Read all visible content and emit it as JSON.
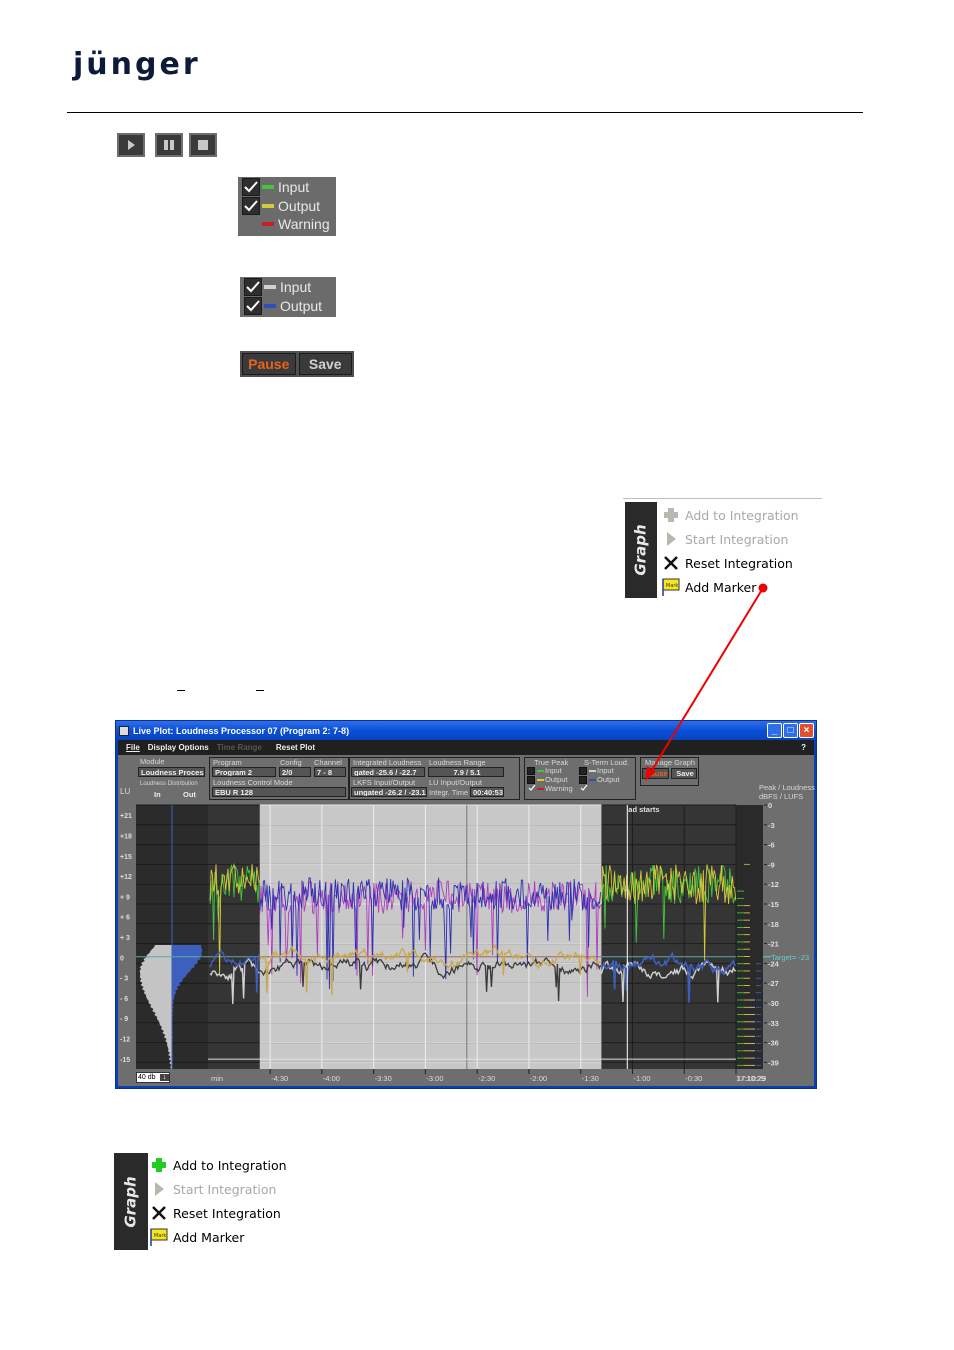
{
  "logo": {
    "text": "jünger"
  },
  "transport": {
    "buttons": [
      {
        "name": "play",
        "icon": "play-icon"
      },
      {
        "name": "pause",
        "icon": "pause-icon"
      },
      {
        "name": "stop",
        "icon": "stop-icon"
      }
    ]
  },
  "true_peak_legend": {
    "items": [
      {
        "label": "Input",
        "checked": true,
        "color": "#44c43c"
      },
      {
        "label": "Output",
        "checked": true,
        "color": "#d8c83c"
      },
      {
        "label": "Warning",
        "checked": false,
        "color": "#c81e28"
      }
    ]
  },
  "short_term_legend": {
    "items": [
      {
        "label": "Input",
        "checked": true,
        "color": "#d0d0d0"
      },
      {
        "label": "Output",
        "checked": true,
        "color": "#2f4fb8"
      }
    ]
  },
  "manage_buttons": {
    "pause": "Pause",
    "save": "Save",
    "pause_color": "#e8641e"
  },
  "graph_menu_top": {
    "tab": "Graph",
    "items": [
      {
        "label": "Add to Integration",
        "icon": "plus-icon",
        "enabled": false
      },
      {
        "label": "Start Integration",
        "icon": "play-icon",
        "enabled": false
      },
      {
        "label": "Reset Integration",
        "icon": "cross-icon",
        "enabled": true
      },
      {
        "label": "Add Marker",
        "icon": "marker-flag-icon",
        "enabled": true
      }
    ]
  },
  "graph_menu_bottom": {
    "tab": "Graph",
    "items": [
      {
        "label": "Add to Integration",
        "icon": "plus-icon",
        "enabled": true
      },
      {
        "label": "Start Integration",
        "icon": "play-icon",
        "enabled": false
      },
      {
        "label": "Reset Integration",
        "icon": "cross-icon",
        "enabled": true
      },
      {
        "label": "Add Marker",
        "icon": "marker-flag-icon",
        "enabled": true
      }
    ]
  },
  "window": {
    "title": "Live Plot:  Loudness Processor 07  (Program 2: 7-8)",
    "menu": {
      "file": "File",
      "display_options": "Display Options",
      "time_range": "Time Range",
      "reset_plot": "Reset Plot",
      "help": "?"
    },
    "module": {
      "label": "Module",
      "value": "Loudness Process"
    },
    "program": {
      "label": "Program",
      "value": "Program 2"
    },
    "config": {
      "label": "Config",
      "value": "2/0"
    },
    "channel": {
      "label": "Channel",
      "value": "7 - 8"
    },
    "control_mode": {
      "label": "Loudness Control Mode",
      "value": "EBU R 128"
    },
    "distribution": {
      "label": "Loudness Distribution",
      "in": "In",
      "out": "Out"
    },
    "lu_label": "LU",
    "integrated": {
      "label": "Integrated Loudness",
      "value": "gated    -25.6 / -22.7"
    },
    "lkfs": {
      "label": "LKFS Input/Output",
      "value": "ungated  -26.2 / -23.1"
    },
    "range": {
      "label": "Loudness Range",
      "value": "7.9 / 5.1"
    },
    "lu_io": {
      "label": "LU Input/Output",
      "integr_label": "Integr. Time",
      "integr_value": "00:40:53"
    },
    "true_peak": {
      "label": "True Peak",
      "input": "Input",
      "output": "Output",
      "warning": "Warning"
    },
    "short_term": {
      "label": "S-Term Loud.",
      "input": "Input",
      "output": "Output"
    },
    "manage": {
      "label": "Manage Graph",
      "pause": "Pause",
      "save": "Save"
    },
    "meter_header": {
      "line1": "Peak / Loudness",
      "line2": "dBFS / LUFS"
    },
    "range_select": "40 db",
    "marker_text": "ad starts",
    "target_label": "Target= -23",
    "clock": "17:10:29"
  },
  "chart_data": {
    "type": "line",
    "title": "Live Plot: Loudness Processor 07 (Program 2: 7-8)",
    "xlabel": "min",
    "x_ticks": [
      "-4:30",
      "-4:00",
      "-3:30",
      "-3:00",
      "-2:30",
      "-2:00",
      "-1:30",
      "-1:00",
      "-0:30",
      "17:10:29"
    ],
    "left_axis": {
      "label": "LU",
      "ticks": [
        "+21",
        "+18",
        "+15",
        "+12",
        "+ 9",
        "+ 6",
        "+ 3",
        "0",
        "- 3",
        "- 6",
        "- 9",
        "-12",
        "-15"
      ],
      "range": [
        -16.5,
        22.5
      ]
    },
    "right_axis": {
      "label": "Peak / Loudness dBFS / LUFS",
      "ticks": [
        "0",
        "-3",
        "-6",
        "-9",
        "-12",
        "-15",
        "-18",
        "-21",
        "-24",
        "-27",
        "-30",
        "-33",
        "-36",
        "-39"
      ],
      "range": [
        -40,
        0
      ]
    },
    "target_lufs": -23,
    "x_range_min": [
      -5.1,
      0
    ],
    "integration_window_min": [
      -4.6,
      -1.3
    ],
    "marker_min": -1.05,
    "series": [
      {
        "name": "True Peak Input",
        "color": "#44c43c",
        "approx_level_dbfs": -12
      },
      {
        "name": "True Peak Output",
        "color": "#d8c83c",
        "approx_level_dbfs": -12
      },
      {
        "name": "S-Term Input",
        "color": "#d0d0d0",
        "approx_level_lufs": -25
      },
      {
        "name": "S-Term Output",
        "color": "#2f4fb8",
        "approx_level_lufs": -23.5
      }
    ],
    "meter": {
      "peak_input_dbfs": -13,
      "peak_output_dbfs": -15,
      "peak_hold_dbfs": -9,
      "loudness_in_lufs": -28.5,
      "loudness_out_lufs": -23
    }
  }
}
